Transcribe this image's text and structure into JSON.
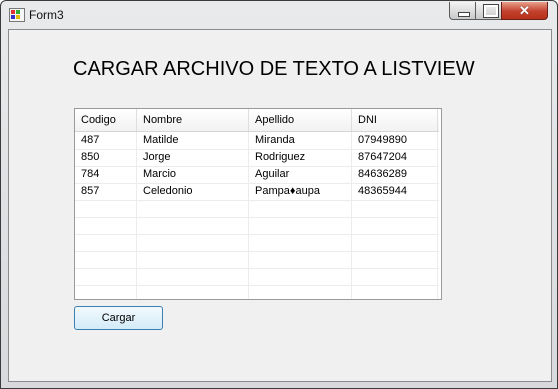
{
  "window": {
    "title": "Form3"
  },
  "heading": "CARGAR ARCHIVO DE TEXTO A LISTVIEW",
  "listview": {
    "columns": [
      "Codigo",
      "Nombre",
      "Apellido",
      "DNI"
    ],
    "rows": [
      [
        "487",
        "Matilde",
        "Miranda",
        "07949890"
      ],
      [
        "850",
        "Jorge",
        "Rodriguez",
        "87647204"
      ],
      [
        "784",
        "Marcio",
        "Aguilar",
        "84636289"
      ],
      [
        "857",
        "Celedonio",
        "Pampa♦aupa",
        "48365944"
      ],
      [
        "",
        "",
        "",
        ""
      ],
      [
        "",
        "",
        "",
        ""
      ],
      [
        "",
        "",
        "",
        ""
      ],
      [
        "",
        "",
        "",
        ""
      ],
      [
        "",
        "",
        "",
        ""
      ],
      [
        "",
        "",
        "",
        ""
      ]
    ]
  },
  "buttons": {
    "cargar": "Cargar"
  },
  "colors": {
    "close_button": "#c3402c",
    "button_border": "#3c7fb1"
  }
}
